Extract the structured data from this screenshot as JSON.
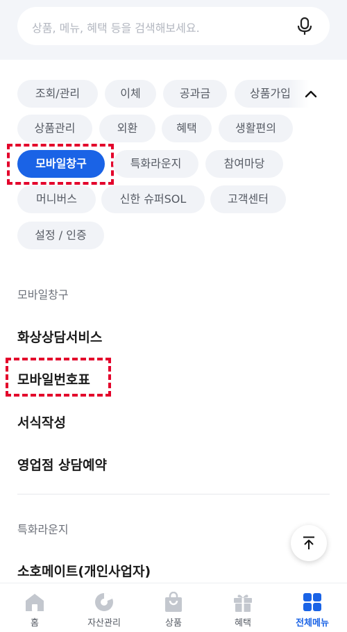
{
  "search": {
    "placeholder": "상품, 메뉴, 혜택 등을 검색해보세요."
  },
  "chips": [
    {
      "label": "조회/관리"
    },
    {
      "label": "이체"
    },
    {
      "label": "공과금"
    },
    {
      "label": "상품가입"
    },
    {
      "label": "상품관리"
    },
    {
      "label": "외환"
    },
    {
      "label": "혜택"
    },
    {
      "label": "생활편의"
    },
    {
      "label": "모바일창구",
      "active": true
    },
    {
      "label": "특화라운지"
    },
    {
      "label": "참여마당"
    },
    {
      "label": "머니버스"
    },
    {
      "label": "신한 슈퍼SOL"
    },
    {
      "label": "고객센터"
    },
    {
      "label": "설정 / 인증"
    }
  ],
  "sections": [
    {
      "title": "모바일창구",
      "items": [
        "화상상담서비스",
        "모바일번호표",
        "서식작성",
        "영업점 상담예약"
      ]
    },
    {
      "title": "특화라운지",
      "items": [
        "소호메이트(개인사업자)"
      ]
    }
  ],
  "bottom_nav": [
    {
      "label": "홈",
      "icon": "home-icon"
    },
    {
      "label": "자산관리",
      "icon": "pie-chart-icon"
    },
    {
      "label": "상품",
      "icon": "shopping-bag-icon"
    },
    {
      "label": "혜택",
      "icon": "gift-icon"
    },
    {
      "label": "전체메뉴",
      "icon": "grid-menu-icon",
      "active": true
    }
  ],
  "colors": {
    "accent": "#1a63e6",
    "highlight": "#e3002b",
    "chip_bg": "#f1f3f7"
  }
}
